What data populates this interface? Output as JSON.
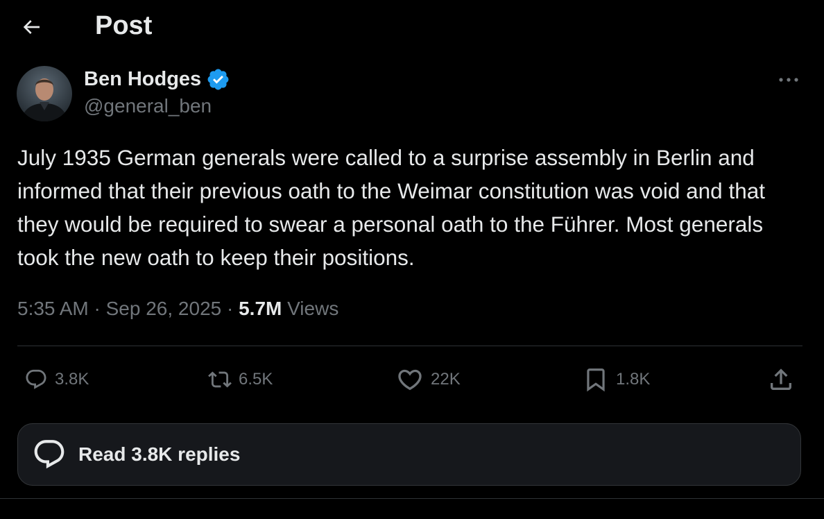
{
  "header": {
    "title": "Post",
    "back_icon": "arrow-left-icon"
  },
  "post": {
    "author": {
      "name": "Ben Hodges",
      "handle": "@general_ben",
      "verified": true,
      "verified_color": "#1d9bf0"
    },
    "text": "July 1935 German generals were called to a surprise assembly in Berlin and informed that their previous oath to the Weimar constitution was void and that they would be required to swear a personal oath to the Führer. Most generals took the new oath to keep their positions.",
    "time": "5:35 AM",
    "date": "Sep 26, 2025",
    "views_count": "5.7M",
    "views_label": "Views",
    "more_icon": "more-horizontal-icon"
  },
  "actions": {
    "replies": {
      "count": "3.8K",
      "icon": "reply-bubble-icon"
    },
    "reposts": {
      "count": "6.5K",
      "icon": "repost-icon"
    },
    "likes": {
      "count": "22K",
      "icon": "heart-icon"
    },
    "bookmarks": {
      "count": "1.8K",
      "icon": "bookmark-icon"
    },
    "share": {
      "icon": "share-upload-icon"
    }
  },
  "read_replies": {
    "label": "Read 3.8K replies",
    "icon": "replies-bubble-icon"
  },
  "colors": {
    "background": "#000000",
    "primary_text": "#e7e9ea",
    "secondary_text": "#71767b",
    "border": "#2f3336",
    "card_background": "#16181c"
  }
}
